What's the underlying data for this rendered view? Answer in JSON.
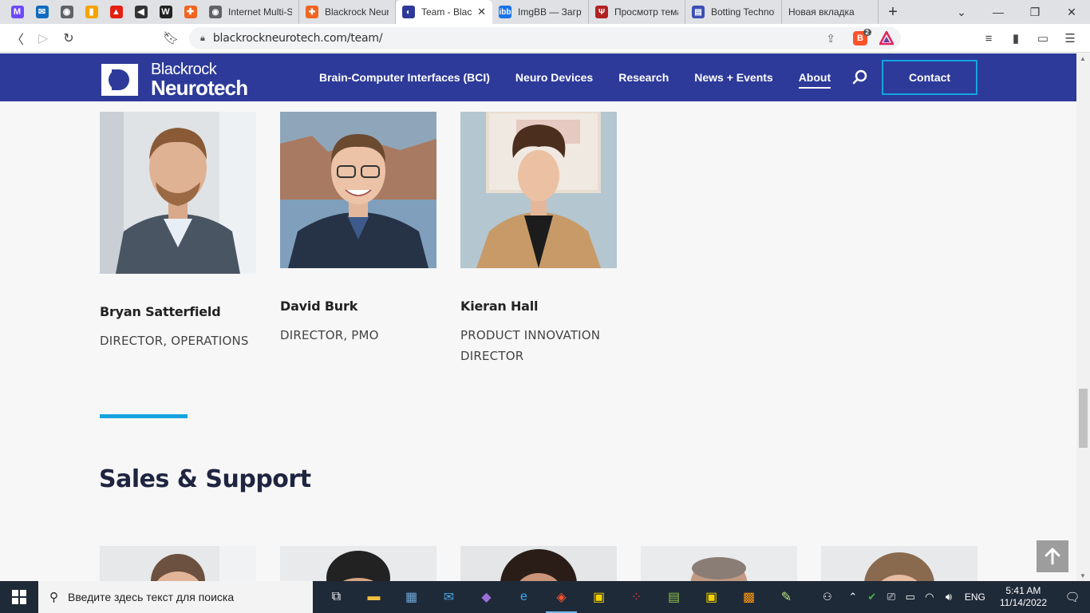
{
  "browser": {
    "pinned": [
      {
        "name": "proton-mail-icon",
        "glyph": "M",
        "color": "#6d4aff"
      },
      {
        "name": "outlook-icon",
        "glyph": "✉",
        "color": "#0f6cbd"
      },
      {
        "name": "globe-icon",
        "glyph": "◉",
        "color": "#5f6368"
      },
      {
        "name": "analytics-icon",
        "glyph": "▮",
        "color": "#f4a400"
      },
      {
        "name": "sber-icon",
        "glyph": "▲",
        "color": "#e42013"
      },
      {
        "name": "speaker-icon",
        "glyph": "◀",
        "color": "#333333"
      },
      {
        "name": "wikipedia-icon",
        "glyph": "W",
        "color": "#222222"
      },
      {
        "name": "plus-cross-icon",
        "glyph": "✚",
        "color": "#f26522"
      }
    ],
    "tabs": [
      {
        "title": "Internet Multi-S",
        "fav": "◉",
        "color": "#5f6368",
        "active": false
      },
      {
        "title": "Blackrock Neuro",
        "fav": "✚",
        "color": "#f26522",
        "active": false
      },
      {
        "title": "Team - Black",
        "fav": "◐",
        "color": "#2d3a99",
        "active": true
      },
      {
        "title": "ImgBB — Загру",
        "fav": "ibb",
        "color": "#1a73e8",
        "active": false
      },
      {
        "title": "Просмотр тема",
        "fav": "Ψ",
        "color": "#b22222",
        "active": false
      },
      {
        "title": "Botting Technol",
        "fav": "▤",
        "color": "#3c4fb4",
        "active": false
      },
      {
        "title": "Новая вкладка",
        "fav": "",
        "color": "transparent",
        "active": false
      }
    ],
    "url": "blackrockneurotech.com/team/",
    "brave_badge": "2"
  },
  "site": {
    "logo_line1": "Blackrock",
    "logo_line2": "Neurotech",
    "nav": [
      "Brain-Computer Interfaces (BCI)",
      "Neuro Devices",
      "Research",
      "News + Events",
      "About"
    ],
    "nav_current": "About",
    "contact_label": "Contact",
    "colors": {
      "header": "#2d3a99",
      "accent": "#15a4e0"
    }
  },
  "team": [
    {
      "name": "Bryan Satterfield",
      "role": "Director, Operations"
    },
    {
      "name": "David Burk",
      "role": "Director, PMO"
    },
    {
      "name": "Kieran Hall",
      "role": "Product Innovation Director"
    }
  ],
  "section_title": "Sales & Support",
  "taskbar": {
    "search_placeholder": "Введите здесь текст для поиска",
    "lang": "ENG",
    "time": "5:41 AM",
    "date": "11/14/2022"
  }
}
